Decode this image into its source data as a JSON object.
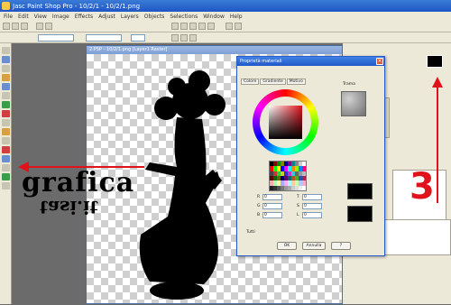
{
  "app": {
    "title": "Jasc Paint Shop Pro - 10/2/1 - 10/2/1.png"
  },
  "menu": [
    "File",
    "Edit",
    "View",
    "Image",
    "Effects",
    "Adjust",
    "Layers",
    "Objects",
    "Selections",
    "Window",
    "Help"
  ],
  "document": {
    "title": "2.PSP - 10/2/1.png [Layer1 Raster]"
  },
  "dialog": {
    "title": "Proprietà materiali",
    "tabs": [
      "Colore",
      "Gradiente",
      "Motivo"
    ],
    "fields": [
      {
        "label": "R",
        "value": "0"
      },
      {
        "label": "G",
        "value": "0"
      },
      {
        "label": "B",
        "value": "0"
      },
      {
        "label": "T",
        "value": "0"
      },
      {
        "label": "S",
        "value": "0"
      },
      {
        "label": "L",
        "value": "0"
      }
    ],
    "checkbox_label": "Tutti",
    "buttons": [
      "OK",
      "Annulla",
      "?"
    ],
    "texture_label": "Trama"
  },
  "annotation": {
    "number": "3"
  },
  "watermark": {
    "line1": "grafica",
    "line2": "tasi.it"
  },
  "colors": {
    "accent_red": "#e0121b",
    "titlebar_blue": "#1e56c6"
  }
}
